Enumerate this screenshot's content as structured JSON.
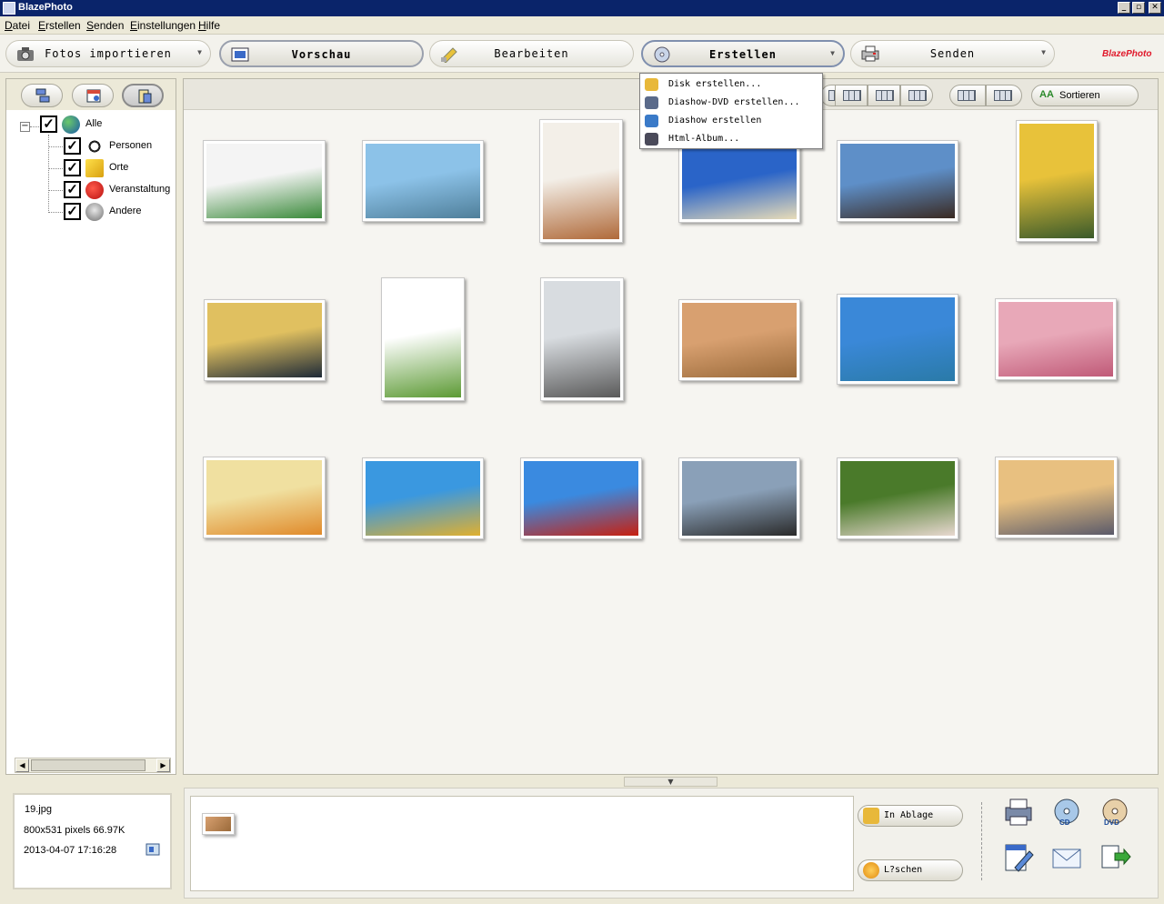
{
  "window": {
    "title": "BlazePhoto",
    "controls": [
      "_",
      "▫",
      "✕"
    ]
  },
  "menu": [
    "Datei",
    "Erstellen",
    "Senden",
    "Einstellungen",
    "Hilfe"
  ],
  "toolbar": {
    "modes": [
      {
        "label": "Fotos importieren",
        "icon": "camera-icon"
      },
      {
        "label": "Vorschau",
        "icon": "preview-icon",
        "active": true
      },
      {
        "label": "Bearbeiten",
        "icon": "edit-icon"
      },
      {
        "label": "Erstellen",
        "icon": "disc-icon",
        "open": true
      },
      {
        "label": "Senden",
        "icon": "printer-icon"
      }
    ],
    "brand": "BlazePhoto"
  },
  "dropdown": {
    "items": [
      {
        "label": "Disk erstellen...",
        "icon": "disk-icon"
      },
      {
        "label": "Diashow-DVD erstellen...",
        "icon": "dvd-icon"
      },
      {
        "label": "Diashow erstellen",
        "icon": "slideshow-icon"
      },
      {
        "label": "Html-Album...",
        "icon": "html-album-icon"
      }
    ]
  },
  "tree": {
    "root": {
      "label": "Alle",
      "checked": true,
      "icon": "globe-icon"
    },
    "children": [
      {
        "label": "Personen",
        "checked": true,
        "icon": "soccer-ball-icon"
      },
      {
        "label": "Orte",
        "checked": true,
        "icon": "cube-icon"
      },
      {
        "label": "Veranstaltung",
        "checked": true,
        "icon": "apple-icon"
      },
      {
        "label": "Andere",
        "checked": true,
        "icon": "alien-icon"
      }
    ]
  },
  "viewbar": {
    "sort_label": "Sortieren"
  },
  "photos": [
    {
      "colors": [
        "#f4f4f4",
        "#3a8a3a"
      ]
    },
    {
      "colors": [
        "#8cc2e8",
        "#4f7f9a"
      ]
    },
    {
      "colors": [
        "#f3efe8",
        "#b06a3a"
      ]
    },
    {
      "colors": [
        "#2a64c8",
        "#e8dcb8"
      ]
    },
    {
      "colors": [
        "#5e8fc8",
        "#3a2a22"
      ]
    },
    {
      "colors": [
        "#e8c23a",
        "#3a5a2a"
      ]
    },
    {
      "colors": [
        "#e0c060",
        "#1e2a38"
      ]
    },
    {
      "colors": [
        "#ffffff",
        "#5c9a34"
      ]
    },
    {
      "colors": [
        "#d8dce0",
        "#5a5a5a"
      ]
    },
    {
      "colors": [
        "#d8a070",
        "#9a6a3a"
      ]
    },
    {
      "colors": [
        "#3a88d8",
        "#2a7aa8"
      ]
    },
    {
      "colors": [
        "#e8a8b8",
        "#c05a78"
      ]
    },
    {
      "colors": [
        "#f0e0a0",
        "#e08a2a"
      ]
    },
    {
      "colors": [
        "#3a98e0",
        "#e0b030"
      ]
    },
    {
      "colors": [
        "#3a8ae0",
        "#c82010"
      ]
    },
    {
      "colors": [
        "#8aa0b8",
        "#2a2a2a"
      ]
    },
    {
      "colors": [
        "#4a7a2a",
        "#e8d8d0"
      ]
    },
    {
      "colors": [
        "#e8c080",
        "#5a5a6a"
      ]
    }
  ],
  "info": {
    "filename": "19.jpg",
    "dimensions": "800x531 pixels 66.97K",
    "datetime": "2013-04-07 17:16:28"
  },
  "tray": {
    "add_label": "In Ablage",
    "delete_label": "L?schen"
  },
  "actions": [
    "print-icon",
    "cd-icon",
    "dvd-icon",
    "html-edit-icon",
    "email-icon",
    "export-icon"
  ]
}
